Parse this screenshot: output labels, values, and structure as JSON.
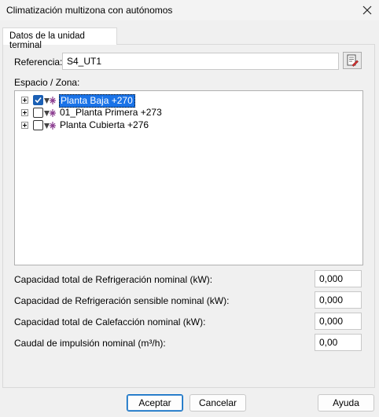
{
  "window": {
    "title": "Climatización multizona con autónomos"
  },
  "tabs": [
    {
      "label": "Datos de la unidad terminal"
    }
  ],
  "form": {
    "referencia": {
      "label": "Referencia:",
      "value": "S4_UT1"
    },
    "space_label": "Espacio / Zona:",
    "tree": [
      {
        "label": "Planta Baja +270",
        "checked": true,
        "selected": true
      },
      {
        "label": "01_Planta Primera +273",
        "checked": false,
        "selected": false
      },
      {
        "label": "Planta Cubierta +276",
        "checked": false,
        "selected": false
      }
    ],
    "fields": [
      {
        "label": "Capacidad total de Refrigeración nominal (kW):",
        "value": "0,000"
      },
      {
        "label": "Capacidad de Refrigeración sensible nominal (kW):",
        "value": "0,000"
      },
      {
        "label": "Capacidad total de Calefacción nominal (kW):",
        "value": "0,000"
      },
      {
        "label": "Caudal de impulsión nominal (m³/h):",
        "value": "0,00"
      }
    ]
  },
  "buttons": {
    "accept": "Aceptar",
    "cancel": "Cancelar",
    "help": "Ayuda"
  },
  "colors": {
    "selection": "#1a73e8",
    "checkbox": "#1a5fb4",
    "zone_icon": "#8a3b8f"
  }
}
